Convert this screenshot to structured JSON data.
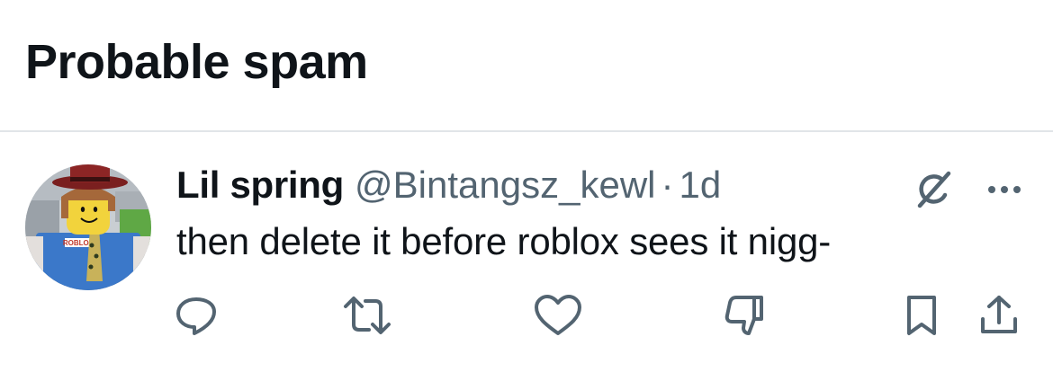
{
  "section": {
    "title": "Probable spam"
  },
  "tweet": {
    "display_name": "Lil spring",
    "handle": "@Bintangsz_kewl",
    "separator": "·",
    "timestamp": "1d",
    "text": "then delete it before roblox sees it nigg-",
    "avatar_shirt_text": "ROBLOX"
  },
  "icons": {
    "grok": "grok-icon",
    "more": "more-icon",
    "reply": "reply-icon",
    "retweet": "retweet-icon",
    "like": "heart-icon",
    "dislike": "thumbs-down-icon",
    "bookmark": "bookmark-icon",
    "share": "share-icon"
  },
  "colors": {
    "text_primary": "#0f1419",
    "text_secondary": "#536471",
    "divider": "#e1e5e8",
    "background": "#ffffff"
  }
}
